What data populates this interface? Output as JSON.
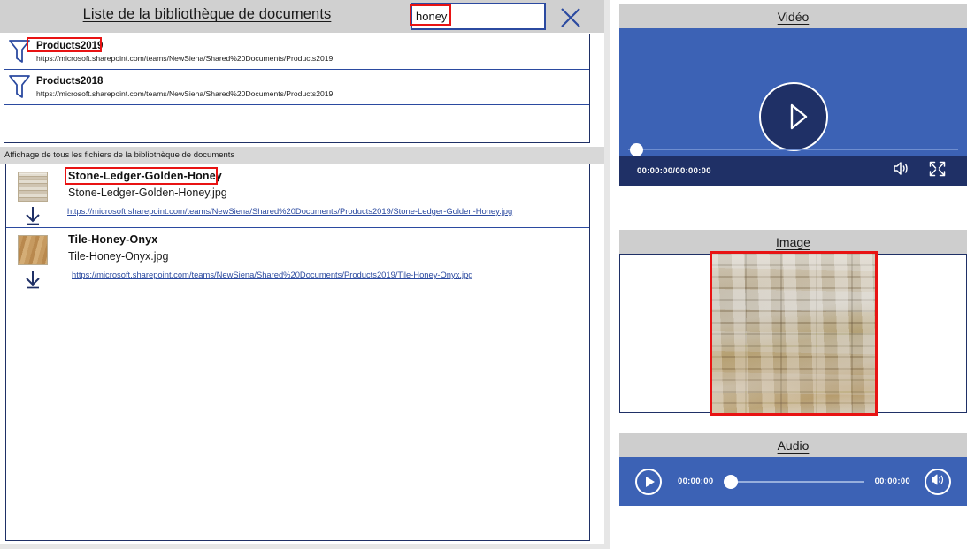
{
  "library": {
    "title": "Liste de la bibliothèque de documents",
    "search": {
      "value": "honey",
      "placeholder": ""
    },
    "close_label": "close-icon",
    "filters": [
      {
        "name": "Products2019",
        "url": "https://microsoft.sharepoint.com/teams/NewSiena/Shared%20Documents/Products2019"
      },
      {
        "name": "Products2018",
        "url": "https://microsoft.sharepoint.com/teams/NewSiena/Shared%20Documents/Products2019"
      }
    ],
    "status_text": "Affichage de tous les fichiers de la bibliothèque de documents",
    "files": [
      {
        "title": "Stone-Ledger-Golden-Honey",
        "filename": "Stone-Ledger-Golden-Honey.jpg",
        "url": "https://microsoft.sharepoint.com/teams/NewSiena/Shared%20Documents/Products2019/Stone-Ledger-Golden-Honey.jpg"
      },
      {
        "title": "Tile-Honey-Onyx",
        "filename": "Tile-Honey-Onyx.jpg",
        "url": "https://microsoft.sharepoint.com/teams/NewSiena/Shared%20Documents/Products2019/Tile-Honey-Onyx.jpg"
      }
    ]
  },
  "video": {
    "header": "Vidéo",
    "time": "00:00:00/00:00:00",
    "play_label": "play-icon",
    "volume_label": "volume-icon",
    "fullscreen_label": "fullscreen-icon"
  },
  "image": {
    "header": "Image",
    "alt": "stone-ledger-texture"
  },
  "audio": {
    "header": "Audio",
    "current_time": "00:00:00",
    "total_time": "00:00:00",
    "play_label": "play-icon",
    "volume_label": "volume-icon"
  },
  "colors": {
    "accent_blue": "#3c62b5",
    "dark_blue": "#1f3066",
    "border_blue": "#2b4aa0",
    "highlight_red": "#e81313",
    "header_gray": "#cecece"
  }
}
